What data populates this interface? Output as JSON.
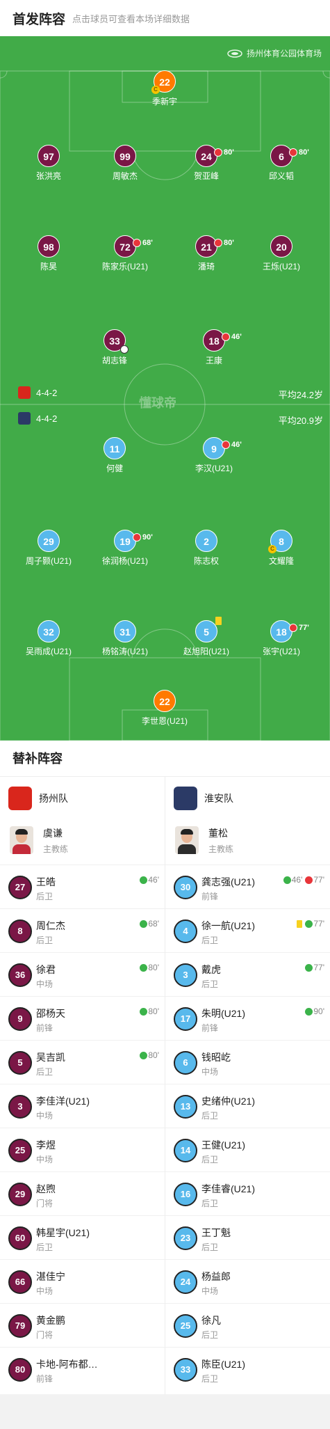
{
  "header": {
    "title": "首发阵容",
    "hint": "点击球员可查看本场详细数据"
  },
  "venue": {
    "name": "扬州体育公园体育场",
    "icon": "stadium-icon"
  },
  "watermark": "懂球帝",
  "home_formation": {
    "text": "4-4-2",
    "avg_age": "平均24.2岁"
  },
  "away_formation": {
    "text": "4-4-2",
    "avg_age": "平均20.9岁"
  },
  "home_lineup": [
    {
      "num": "22",
      "name": "季新宇",
      "gk": true,
      "captain": true,
      "captain_label": "C"
    },
    {
      "num": "97",
      "name": "张洪亮"
    },
    {
      "num": "99",
      "name": "周敏杰"
    },
    {
      "num": "24",
      "name": "贺亚峰",
      "sub_min": "80'"
    },
    {
      "num": "6",
      "name": "邱义韬",
      "sub_min": "80'"
    },
    {
      "num": "98",
      "name": "陈昊"
    },
    {
      "num": "72",
      "name": "陈家乐(U21)",
      "sub_min": "68'"
    },
    {
      "num": "21",
      "name": "潘琦",
      "sub_min": "80'"
    },
    {
      "num": "20",
      "name": "王烁(U21)"
    },
    {
      "num": "33",
      "name": "胡志锋",
      "goal": true
    },
    {
      "num": "18",
      "name": "王康",
      "sub_min": "46'"
    }
  ],
  "away_lineup": [
    {
      "num": "11",
      "name": "何健"
    },
    {
      "num": "9",
      "name": "李汉(U21)",
      "sub_min": "46'"
    },
    {
      "num": "29",
      "name": "周子颢(U21)"
    },
    {
      "num": "19",
      "name": "徐润杨(U21)",
      "sub_min": "90'"
    },
    {
      "num": "2",
      "name": "陈志权"
    },
    {
      "num": "8",
      "name": "文耀隆",
      "captain": true,
      "captain_label": "C"
    },
    {
      "num": "32",
      "name": "吴雨成(U21)"
    },
    {
      "num": "31",
      "name": "杨铭涛(U21)"
    },
    {
      "num": "5",
      "name": "赵旭阳(U21)",
      "yellow": true
    },
    {
      "num": "18",
      "name": "张宇(U21)",
      "sub_min": "77'"
    },
    {
      "num": "22",
      "name": "李世恩(U21)",
      "gk": true
    }
  ],
  "subs": {
    "title": "替补阵容",
    "home": {
      "team": "扬州队",
      "coach": {
        "name": "虞谦",
        "role": "主教练"
      },
      "players": [
        {
          "num": "27",
          "name": "王皓",
          "pos": "后卫",
          "in": "46'"
        },
        {
          "num": "8",
          "name": "周仁杰",
          "pos": "后卫",
          "in": "68'"
        },
        {
          "num": "36",
          "name": "徐君",
          "pos": "中场",
          "in": "80'"
        },
        {
          "num": "9",
          "name": "邵杨天",
          "pos": "前锋",
          "in": "80'"
        },
        {
          "num": "5",
          "name": "吴吉凯",
          "pos": "后卫",
          "in": "80'"
        },
        {
          "num": "3",
          "name": "李佳洋(U21)",
          "pos": "中场"
        },
        {
          "num": "25",
          "name": "李煜",
          "pos": "中场"
        },
        {
          "num": "29",
          "name": "赵煦",
          "pos": "门将"
        },
        {
          "num": "60",
          "name": "韩星宇(U21)",
          "pos": "后卫"
        },
        {
          "num": "66",
          "name": "湛佳宁",
          "pos": "中场"
        },
        {
          "num": "79",
          "name": "黄金鹏",
          "pos": "门将"
        },
        {
          "num": "80",
          "name": "卡地-阿布都…",
          "pos": "前锋"
        }
      ]
    },
    "away": {
      "team": "淮安队",
      "coach": {
        "name": "董松",
        "role": "主教练"
      },
      "players": [
        {
          "num": "30",
          "name": "龚志强(U21)",
          "pos": "前锋",
          "in": "46'",
          "out": "77'"
        },
        {
          "num": "4",
          "name": "徐一航(U21)",
          "pos": "后卫",
          "card": true,
          "in": "77'"
        },
        {
          "num": "3",
          "name": "戴虎",
          "pos": "后卫",
          "in": "77'"
        },
        {
          "num": "17",
          "name": "朱明(U21)",
          "pos": "前锋",
          "in": "90'"
        },
        {
          "num": "6",
          "name": "钱昭屹",
          "pos": "中场"
        },
        {
          "num": "13",
          "name": "史绪仲(U21)",
          "pos": "后卫"
        },
        {
          "num": "14",
          "name": "王健(U21)",
          "pos": "后卫"
        },
        {
          "num": "16",
          "name": "李佳睿(U21)",
          "pos": "后卫"
        },
        {
          "num": "23",
          "name": "王丁魁",
          "pos": "后卫"
        },
        {
          "num": "24",
          "name": "杨益郎",
          "pos": "中场"
        },
        {
          "num": "25",
          "name": "徐凡",
          "pos": "后卫"
        },
        {
          "num": "33",
          "name": "陈臣(U21)",
          "pos": "后卫"
        }
      ]
    }
  },
  "colors": {
    "pitch": "#41ab48",
    "home": "#7a1746",
    "away": "#58b9ec",
    "gk": "#ff7a00",
    "sub_in": "#3bb34a",
    "sub_out": "#e8353a"
  }
}
